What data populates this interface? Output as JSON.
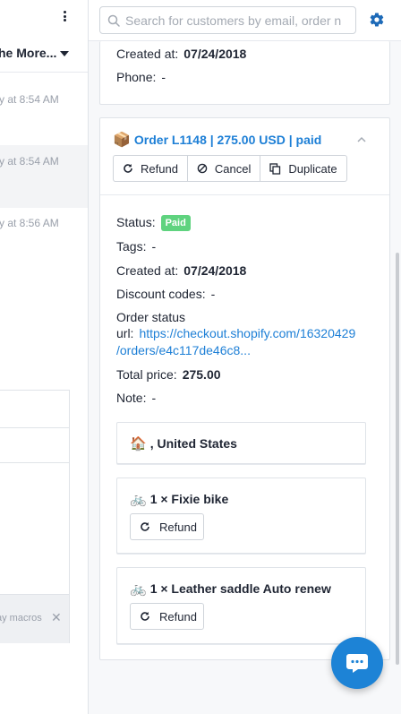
{
  "left_panel": {
    "more_label": "he More...",
    "timestamps": [
      "y at 8:54 AM",
      "y at 8:54 AM",
      "y at 8:56 AM"
    ],
    "macros_hint": "ay macros",
    "close_symbol": "✕"
  },
  "search": {
    "placeholder": "Search for customers by email, order n"
  },
  "customer": {
    "created_label": "Created at:",
    "created_value": "07/24/2018",
    "phone_label": "Phone:",
    "phone_value": "-"
  },
  "order": {
    "emoji": "📦",
    "title": "Order L1148 | 275.00 USD | paid",
    "actions": {
      "refund": "Refund",
      "cancel": "Cancel",
      "duplicate": "Duplicate"
    },
    "fields": {
      "status_label": "Status:",
      "status_badge": "Paid",
      "tags_label": "Tags:",
      "tags_value": "-",
      "created_label": "Created at:",
      "created_value": "07/24/2018",
      "discount_label": "Discount codes:",
      "discount_value": "-",
      "order_status_label_1": "Order status",
      "order_status_label_2": "url:",
      "order_status_url_1": "https://checkout.shopify.com/16320429",
      "order_status_url_2": "/orders/e4c117de46c8...",
      "total_label": "Total price:",
      "total_value": "275.00",
      "note_label": "Note:",
      "note_value": "-"
    },
    "shipping": {
      "emoji": "🏠",
      "text": ", United States"
    },
    "line_items": [
      {
        "emoji": "🚲",
        "text": "1 × Fixie bike",
        "refund": "Refund"
      },
      {
        "emoji": "🚲",
        "text": "1 × Leather saddle Auto renew",
        "refund": "Refund"
      }
    ]
  },
  "colors": {
    "accent": "#1d7fd6",
    "paid_badge": "#5fd37f",
    "chat_button": "#1d83d6"
  },
  "icons": [
    "search-icon",
    "gear-icon",
    "chevron-up-icon",
    "refund-icon",
    "cancel-icon",
    "duplicate-icon",
    "chat-icon",
    "more-vertical-icon",
    "caret-down-icon"
  ]
}
